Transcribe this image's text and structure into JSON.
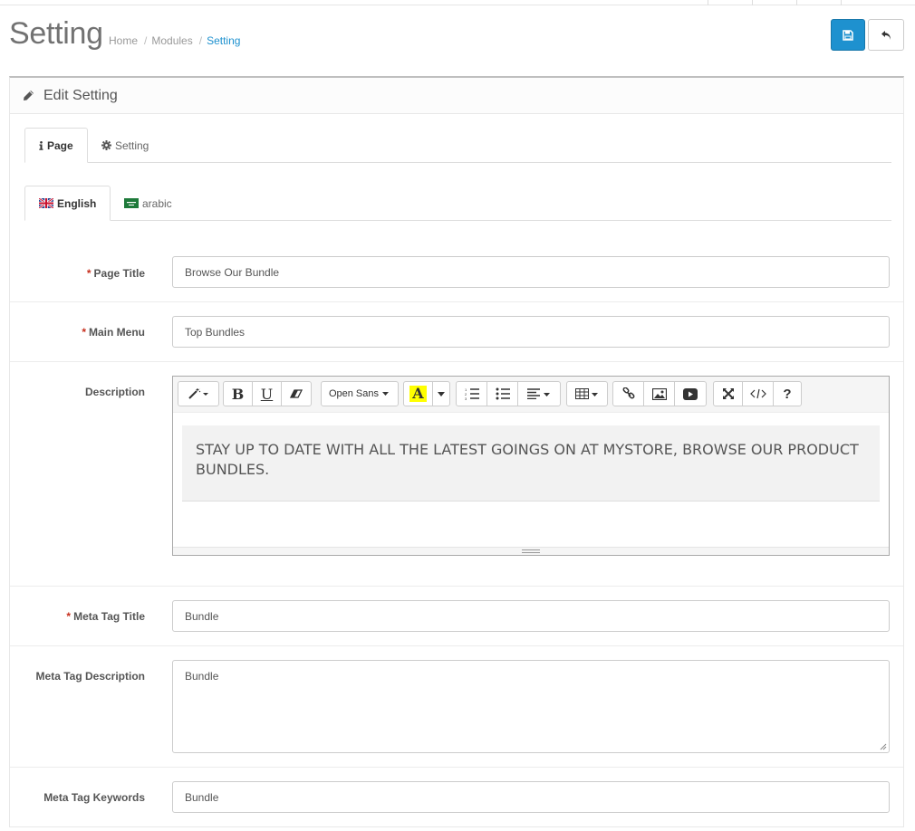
{
  "header": {
    "title": "Setting",
    "breadcrumb": [
      "Home",
      "Modules",
      "Setting"
    ],
    "save_icon": "save-icon",
    "back_icon": "reply-icon"
  },
  "panel": {
    "title": "Edit Setting",
    "icon": "pencil-icon"
  },
  "tabs": [
    {
      "label": "Page",
      "icon": "info-icon",
      "active": true
    },
    {
      "label": "Setting",
      "icon": "gear-icon",
      "active": false
    }
  ],
  "language_tabs": [
    {
      "label": "English",
      "icon": "uk-flag-icon",
      "active": true
    },
    {
      "label": "arabic",
      "icon": "arabic-flag-icon",
      "active": false
    }
  ],
  "form": {
    "page_title": {
      "label": "Page Title",
      "value": "Browse Our Bundle",
      "required": true
    },
    "main_menu": {
      "label": "Main Menu",
      "value": "Top Bundles",
      "required": true
    },
    "description": {
      "label": "Description",
      "font": "Open Sans",
      "content": "STAY UP TO DATE WITH ALL THE LATEST GOINGS ON AT MYSTORE, BROWSE OUR PRODUCT BUNDLES."
    },
    "meta_title": {
      "label": "Meta Tag Title",
      "value": "Bundle",
      "required": true
    },
    "meta_description": {
      "label": "Meta Tag Description",
      "value": "Bundle"
    },
    "meta_keywords": {
      "label": "Meta Tag Keywords",
      "value": "Bundle"
    }
  },
  "required_mark": "*",
  "toolbar": {
    "bold": "B",
    "underline": "U",
    "color_letter": "A",
    "help": "?"
  },
  "colors": {
    "primary": "#1e91cf",
    "required": "#c72f1d",
    "highlight": "#ffff00"
  }
}
